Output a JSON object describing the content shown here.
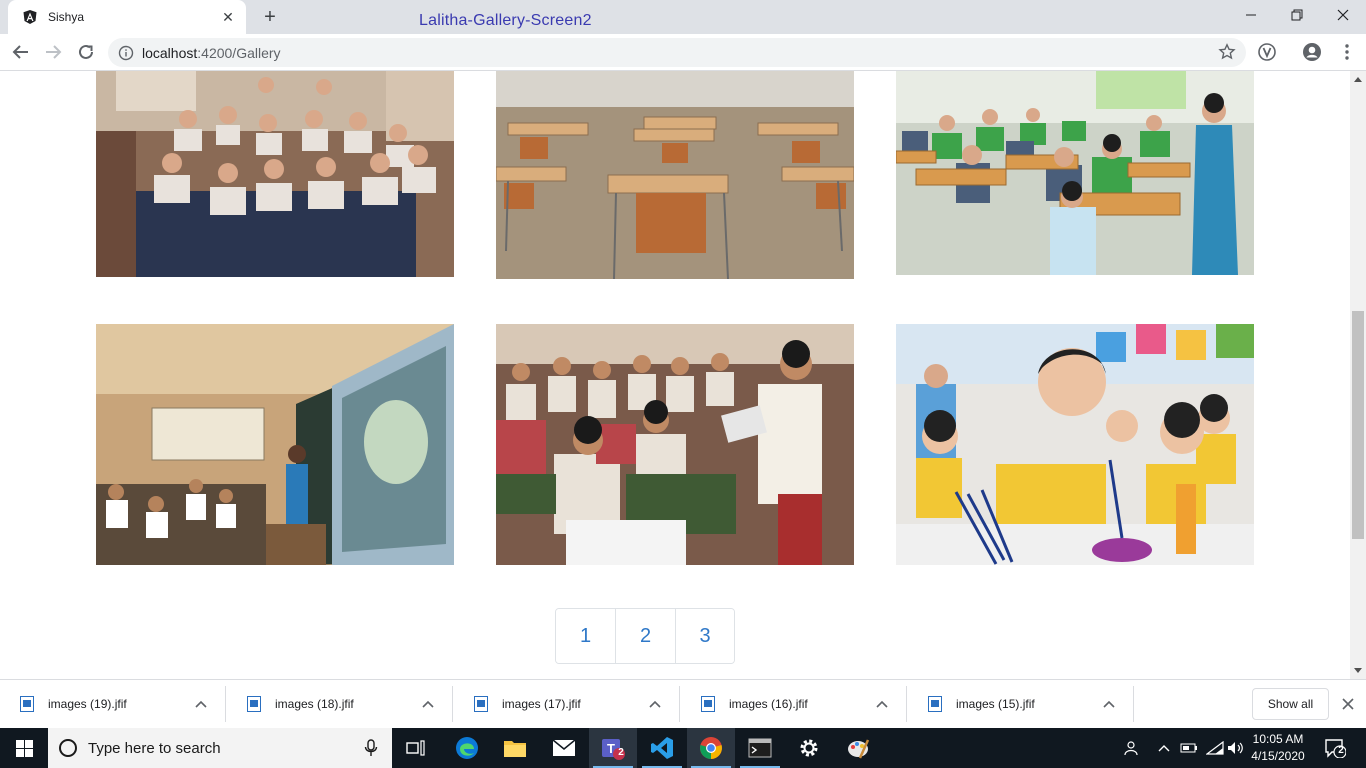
{
  "browser": {
    "tab_title": "Sishya",
    "overlay_title": "Lalitha-Gallery-Screen2",
    "url_host": "localhost",
    "url_path": ":4200/Gallery"
  },
  "gallery": {
    "images": [
      {
        "name": "students-with-certificates"
      },
      {
        "name": "empty-classroom-desks"
      },
      {
        "name": "students-at-desks-with-teacher"
      },
      {
        "name": "smart-classroom-projector"
      },
      {
        "name": "student-reading-aloud"
      },
      {
        "name": "children-painting"
      }
    ]
  },
  "pagination": {
    "pages": [
      "1",
      "2",
      "3"
    ]
  },
  "downloads": {
    "items": [
      "images (19).jfif",
      "images (18).jfif",
      "images (17).jfif",
      "images (16).jfif",
      "images (15).jfif"
    ],
    "show_all": "Show all"
  },
  "taskbar": {
    "search_placeholder": "Type here to search",
    "time": "10:05 AM",
    "date": "4/15/2020",
    "notification_count": "2",
    "teams_badge": "2"
  },
  "colors": {
    "accent": "#2f78c8",
    "overlay_title": "#3a3ab0",
    "taskbar": "#101820"
  }
}
